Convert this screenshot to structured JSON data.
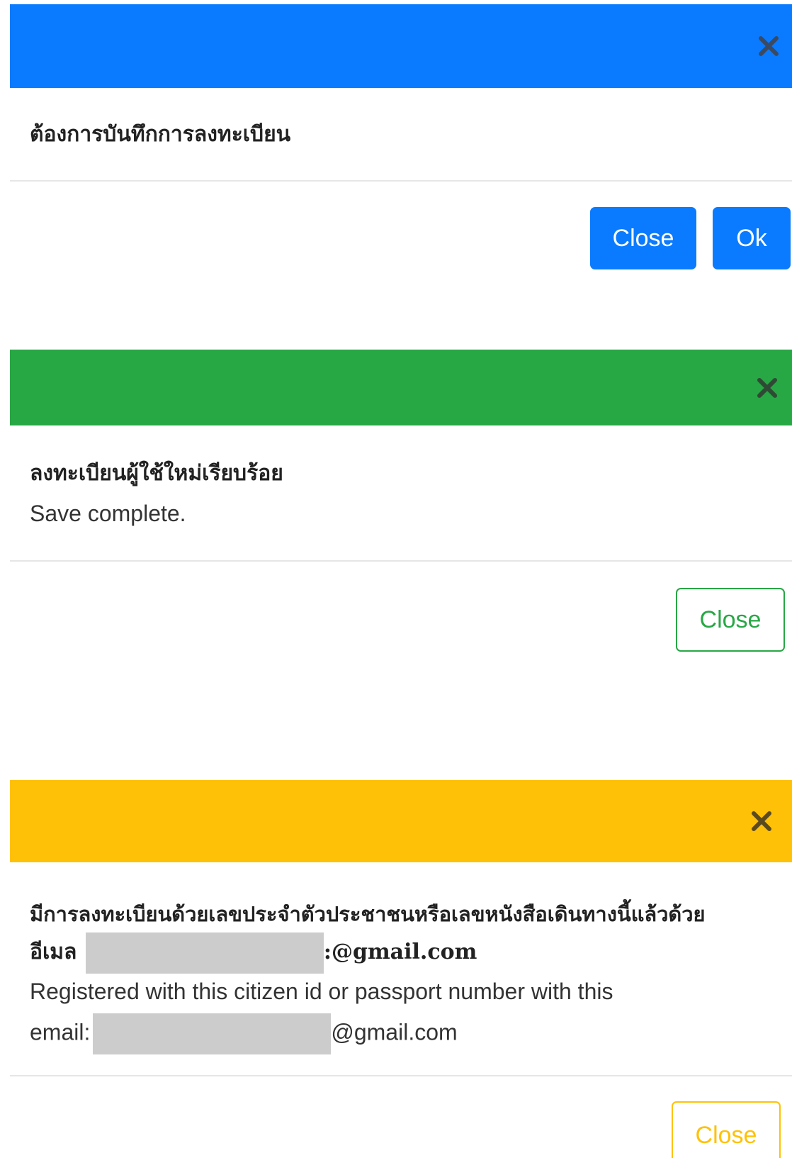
{
  "colors": {
    "primary": "#0a7bff",
    "success": "#28a745",
    "warning": "#ffc107",
    "redaction": "#cccccc"
  },
  "confirm_modal": {
    "close_icon": "close-icon",
    "message_th": "ต้องการบันทึกการลงทะเบียน",
    "close_label": "Close",
    "ok_label": "Ok"
  },
  "success_modal": {
    "close_icon": "close-icon",
    "message_th": "ลงทะเบียนผู้ใช้ใหม่เรียบร้อย",
    "message_en": "Save complete.",
    "close_label": "Close"
  },
  "warning_modal": {
    "close_icon": "close-icon",
    "message_th": "มีการลงทะเบียนด้วยเลขประจำตัวประชาชนหรือเลขหนังสือเดินทางนี้แล้วด้วย",
    "email_label_th": "อีเมล",
    "email_suffix_th": ":@gmail.com",
    "message_en": "Registered with this citizen id or passport number with this",
    "email_label_en": "email:",
    "email_suffix_en": "@gmail.com",
    "close_label": "Close"
  }
}
